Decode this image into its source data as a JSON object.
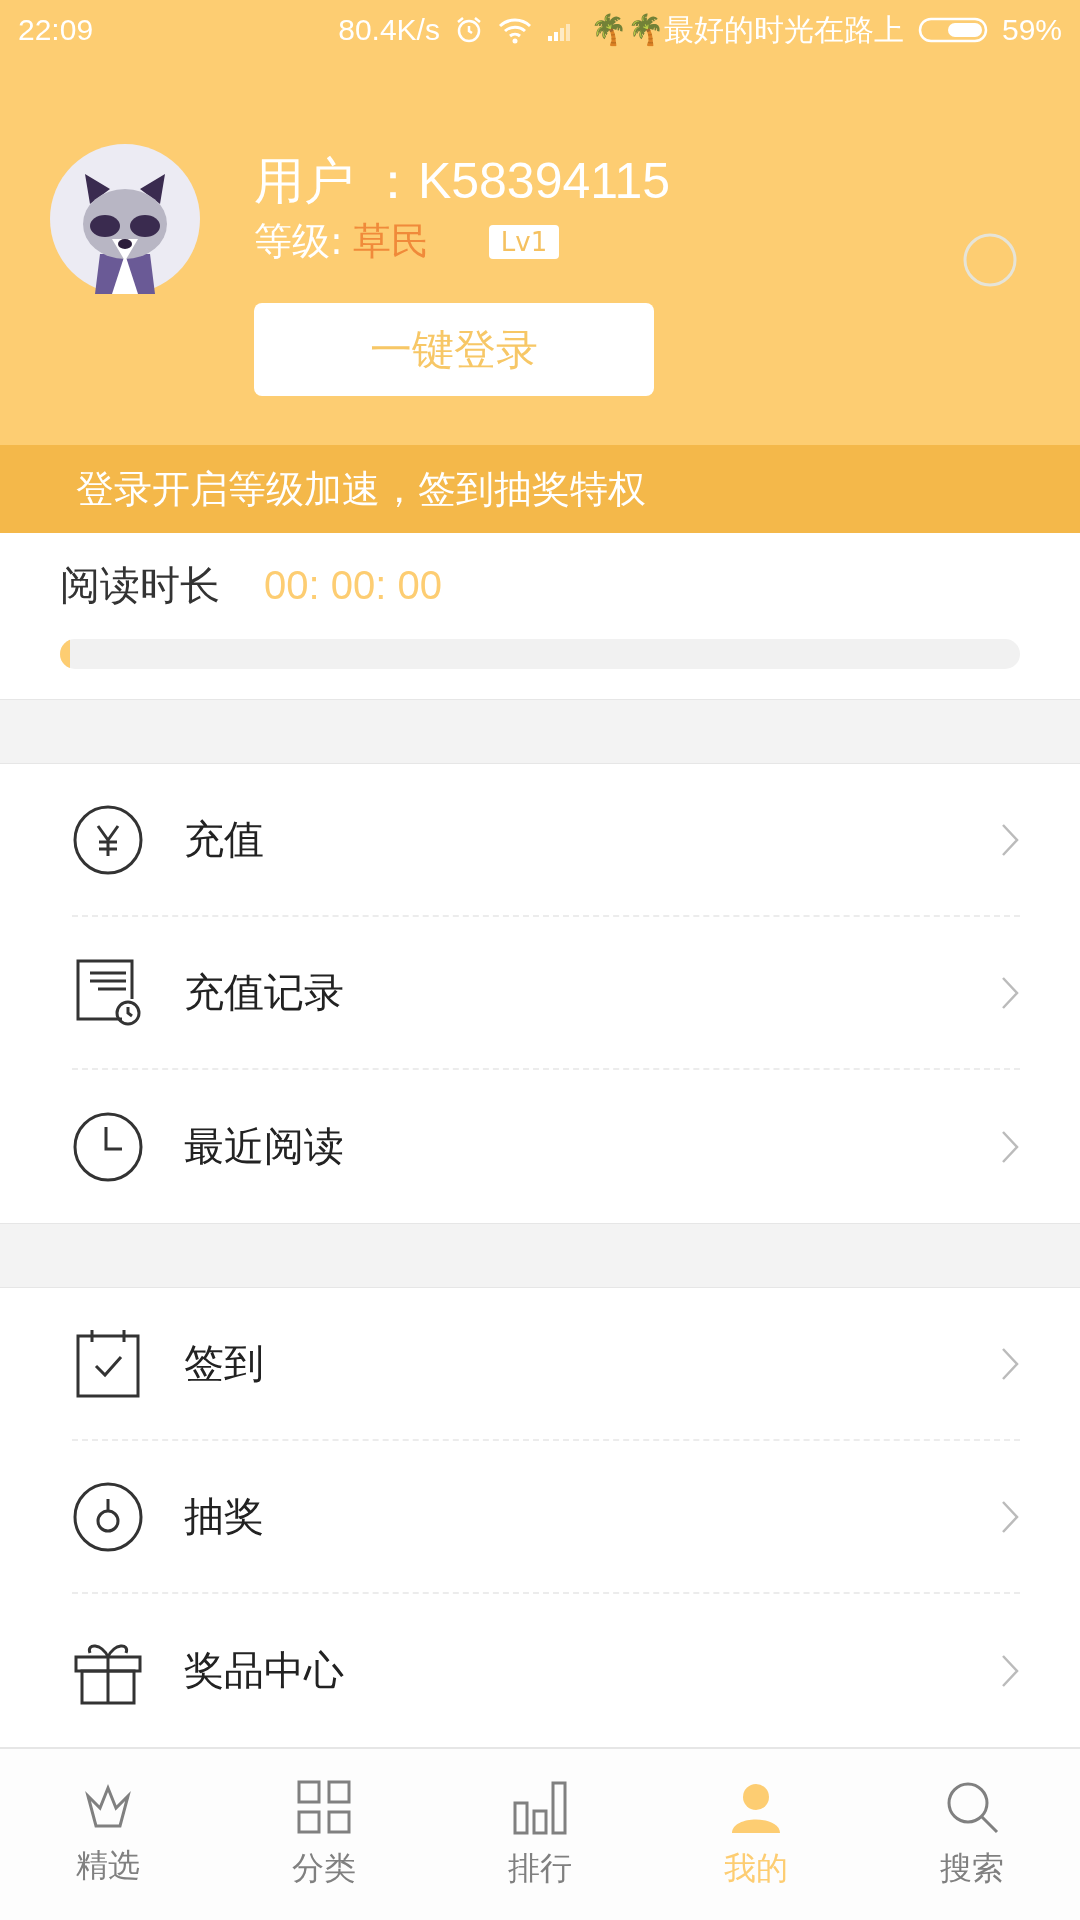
{
  "status_bar": {
    "time": "22:09",
    "speed": "80.4K/s",
    "carrier": "🌴🌴最好的时光在路上",
    "battery": "59%"
  },
  "profile": {
    "username": "用户 ：K58394115",
    "level_label": "等级:",
    "level_name": "草民",
    "badge": "Lv1",
    "login_button": "一键登录"
  },
  "banner": "登录开启等级加速，签到抽奖特权",
  "reading": {
    "label": "阅读时长",
    "time": "00: 00: 00",
    "level": 0.01
  },
  "menu_groups": [
    {
      "items": [
        {
          "kind": "recharge",
          "label": "充值"
        },
        {
          "kind": "record",
          "label": "充值记录"
        },
        {
          "kind": "recent",
          "label": "最近阅读"
        }
      ]
    },
    {
      "items": [
        {
          "kind": "checkin",
          "label": "签到"
        },
        {
          "kind": "lottery",
          "label": "抽奖"
        },
        {
          "kind": "gift",
          "label": "奖品中心"
        }
      ]
    }
  ],
  "tabs": [
    {
      "kind": "crown",
      "label": "精选",
      "selected": false
    },
    {
      "kind": "grid",
      "label": "分类",
      "selected": false
    },
    {
      "kind": "bars",
      "label": "排行",
      "selected": false
    },
    {
      "kind": "user",
      "label": "我的",
      "selected": true
    },
    {
      "kind": "search",
      "label": "搜索",
      "selected": false
    }
  ]
}
